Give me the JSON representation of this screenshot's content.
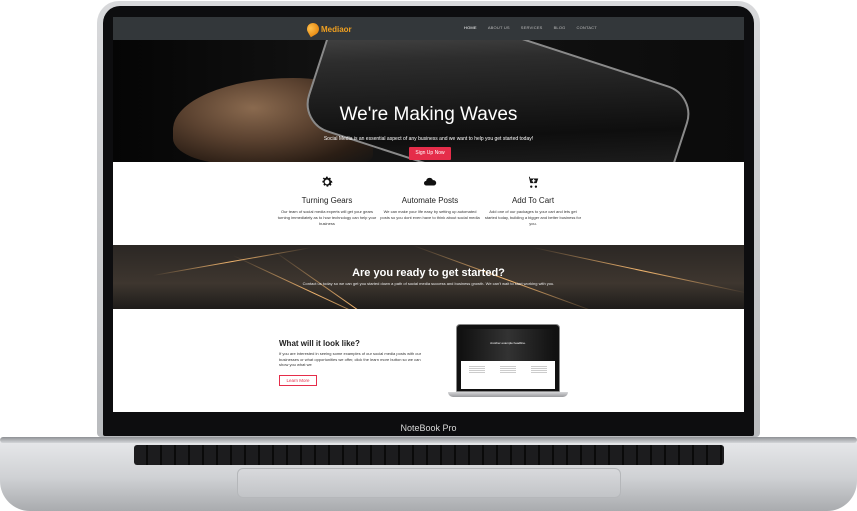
{
  "device": {
    "label": "NoteBook Pro"
  },
  "site": {
    "brand": "Mediaor",
    "nav": [
      "HOME",
      "ABOUT US",
      "SERVICES",
      "BLOG",
      "CONTACT"
    ],
    "hero": {
      "title": "We're Making Waves",
      "subtitle": "Social Media is an essential aspect of any business and we want to help you get started today!",
      "button": "Sign Up Now"
    },
    "features": [
      {
        "icon": "gear-icon",
        "title": "Turning Gears",
        "text": "Our team of social media experts will get your gears turning immediately as to how technology can help your business"
      },
      {
        "icon": "cloud-icon",
        "title": "Automate Posts",
        "text": "We can make your life easy by setting up automated posts so you dont even have to think about social media"
      },
      {
        "icon": "cart-add-icon",
        "title": "Add To Cart",
        "text": "Add one of our packages to your cart and lets get started today, building a bigger and better business for you."
      }
    ],
    "cta": {
      "title": "Are you ready to get started?",
      "text": "Contact us today so we can get you started down a path of social media success and business growth. We can't wait to start working with you."
    },
    "preview": {
      "title": "What will it look like?",
      "text": "If you are interested in seeing some examples of our social media posts with our businesses or what opportunities we offer, click the learn more button so we can show you what we",
      "button": "Learn More",
      "mock_headline": "Another example headline."
    }
  },
  "colors": {
    "accent": "#e52d4a",
    "brand": "#f0a020",
    "navbar": "#33373a"
  }
}
